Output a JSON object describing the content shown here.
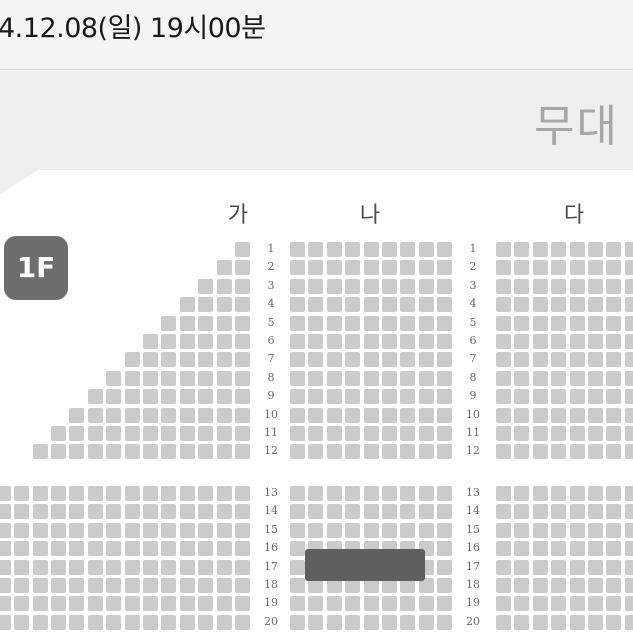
{
  "header": {
    "date_text": "4.12.08(일) 19시00분"
  },
  "stage": {
    "label": "무대"
  },
  "floor": {
    "badge": "1F"
  },
  "sections": [
    {
      "label": "가"
    },
    {
      "label": "나"
    },
    {
      "label": "다"
    }
  ],
  "rows": [
    "1",
    "2",
    "3",
    "4",
    "5",
    "6",
    "7",
    "8",
    "9",
    "10",
    "11",
    "12",
    "13",
    "14",
    "15",
    "16",
    "17",
    "18",
    "19",
    "20"
  ],
  "colors": {
    "seat": "#cbcbcb",
    "selected": "#5f5f5f",
    "badge": "#6d6d6d",
    "stage_text": "#a7a7a7"
  }
}
